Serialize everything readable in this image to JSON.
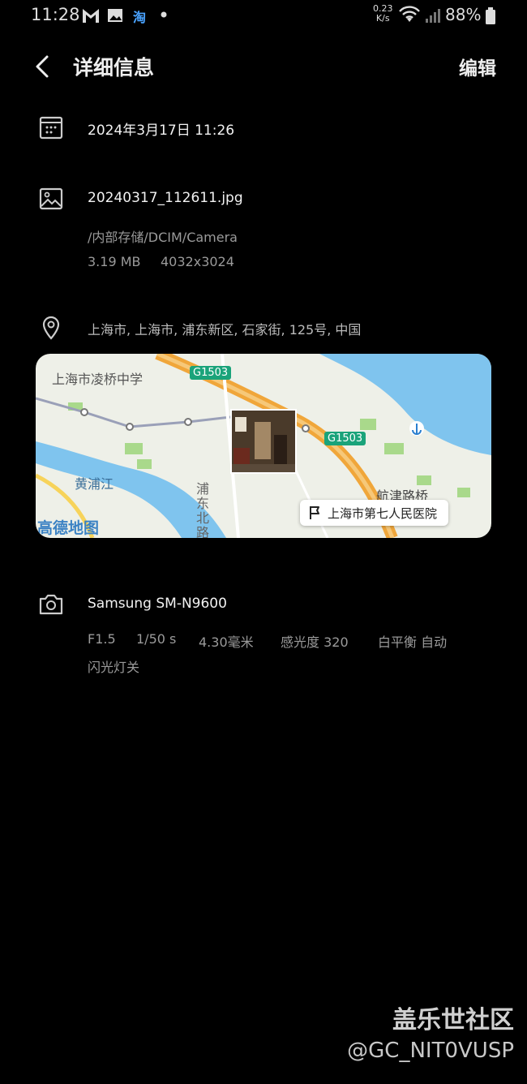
{
  "status_bar": {
    "time": "11:28",
    "net_speed_value": "0.23",
    "net_speed_unit": "K/s",
    "battery": "88%",
    "icons": [
      "gmail-icon",
      "gallery-icon",
      "taobao-icon",
      "dot-icon",
      "wifi-icon",
      "signal-icon",
      "battery-icon"
    ],
    "taobao_glyph": "淘"
  },
  "header": {
    "title": "详细信息",
    "edit_label": "编辑",
    "back_icon": "chevron-left-icon"
  },
  "date_row": {
    "icon": "calendar-icon",
    "text": "2024年3月17日  11:26"
  },
  "file_row": {
    "icon": "image-icon",
    "filename": "20240317_112611.jpg",
    "path": "/内部存储/DCIM/Camera",
    "size": "3.19 MB",
    "resolution": "4032x3024"
  },
  "location_row": {
    "icon": "location-pin-icon",
    "address": "上海市, 上海市, 浦东新区, 石家街, 125号, 中国"
  },
  "map": {
    "labels": {
      "school": "上海市凌桥中学",
      "river": "黄浦江",
      "road_vertical": "浦东北路",
      "bridge": "航津路桥",
      "logo": "高德地图"
    },
    "highways": [
      "G1503",
      "G1503"
    ],
    "poi": {
      "icon": "flag-icon",
      "name": "上海市第七人民医院"
    },
    "colors": {
      "water": "#7fc4ee",
      "land": "#eef0e8",
      "highway": "#f0a63a",
      "park": "#a9d98b",
      "badge": "#1aa37a"
    }
  },
  "camera_row": {
    "icon": "camera-icon",
    "model": "Samsung SM-N9600",
    "aperture": "F1.5",
    "shutter": "1/50 s",
    "focal_length": "4.30毫米",
    "iso": "感光度 320",
    "white_balance": "白平衡 自动",
    "flash": "闪光灯关"
  },
  "watermark": {
    "site": "盖乐世社区",
    "user": "@GC_NIT0VUSP"
  }
}
